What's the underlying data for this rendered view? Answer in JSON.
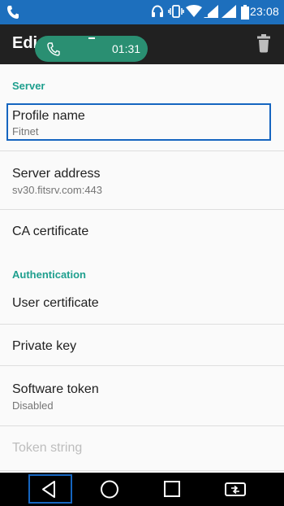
{
  "status_bar": {
    "time": "23:08",
    "icons": [
      "phone-icon",
      "headset-icon",
      "vibrate-icon",
      "wifi-icon",
      "signal-icon",
      "signal-icon",
      "battery-icon"
    ]
  },
  "app_bar": {
    "title": "Edit",
    "delete_icon": "trash-icon"
  },
  "call_pill": {
    "timer": "01:31",
    "icon": "phone-icon"
  },
  "sections": {
    "server": {
      "header": "Server",
      "profile_name": {
        "title": "Profile name",
        "summary": "Fitnet"
      },
      "server_address": {
        "title": "Server address",
        "summary": "sv30.fitsrv.com:443"
      },
      "ca_certificate": {
        "title": "CA certificate"
      }
    },
    "authentication": {
      "header": "Authentication",
      "user_certificate": {
        "title": "User certificate"
      },
      "private_key": {
        "title": "Private key"
      },
      "software_token": {
        "title": "Software token",
        "summary": "Disabled"
      },
      "token_string": {
        "title": "Token string"
      }
    }
  },
  "nav_bar": {
    "buttons": [
      "back-icon",
      "home-icon",
      "recents-icon",
      "screen-mirror-icon"
    ]
  },
  "colors": {
    "status_bar": "#1d6fbd",
    "app_bar": "#212121",
    "accent": "#1e9f8e",
    "call_pill": "#2a8f72",
    "highlight": "#1565c0"
  }
}
